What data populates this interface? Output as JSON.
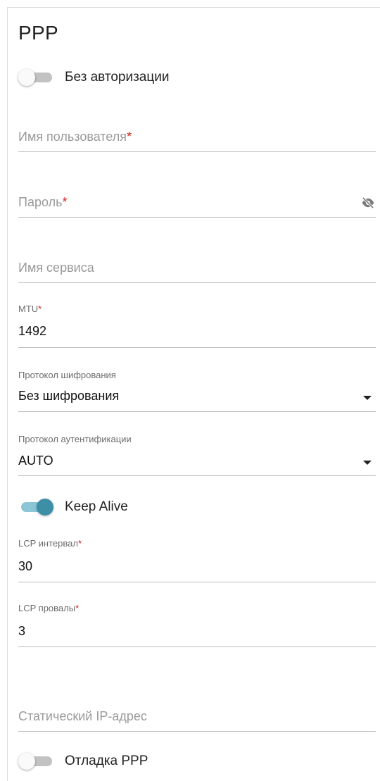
{
  "section": {
    "title": "PPP"
  },
  "no_auth": {
    "label": "Без авторизации",
    "enabled": false
  },
  "username": {
    "placeholder": "Имя пользователя",
    "required_mark": "*",
    "value": ""
  },
  "password": {
    "placeholder": "Пароль",
    "required_mark": "*",
    "value": "",
    "visibility_icon": "eye-off-icon"
  },
  "service_name": {
    "placeholder": "Имя сервиса",
    "value": ""
  },
  "mtu": {
    "label": "MTU",
    "required_mark": "*",
    "value": "1492"
  },
  "encryption": {
    "label": "Протокол шифрования",
    "value": "Без шифрования"
  },
  "authentication": {
    "label": "Протокол аутентификации",
    "value": "AUTO"
  },
  "keep_alive": {
    "label": "Keep Alive",
    "enabled": true
  },
  "lcp_interval": {
    "label": "LCP интервал",
    "required_mark": "*",
    "value": "30"
  },
  "lcp_failures": {
    "label": "LCP провалы",
    "required_mark": "*",
    "value": "3"
  },
  "static_ip": {
    "placeholder": "Статический IP-адрес",
    "value": ""
  },
  "ppp_debug": {
    "label": "Отладка PPP",
    "enabled": false
  },
  "colors": {
    "accent": "#3d8fa6",
    "accent_track": "#8cc6d6",
    "required": "#d0211c",
    "placeholder": "#9a9a9a",
    "underline": "#bdbdbd"
  }
}
